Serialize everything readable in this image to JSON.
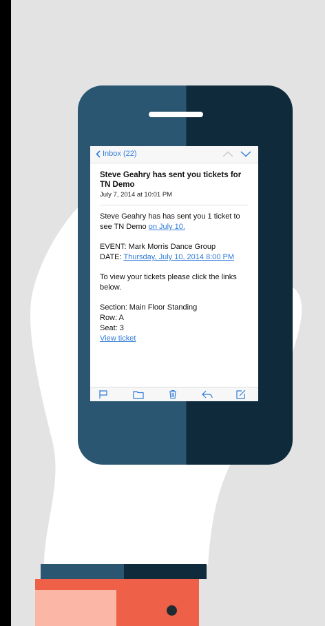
{
  "colors": {
    "background": "#e3e3e3",
    "phone_left": "#2a5672",
    "phone_right": "#0f2a3b",
    "hand": "#ffffff",
    "cuff": "#ee6048",
    "cuff_light": "#fbb6a6",
    "link": "#2f7bd8"
  },
  "nav": {
    "back_label": "Inbox (22)",
    "back_icon": "chevron-left-icon",
    "prev_icon": "chevron-up-icon",
    "next_icon": "chevron-down-icon"
  },
  "email": {
    "subject": "Steve Geahry has sent you tickets for TN Demo",
    "date": "July 7, 2014 at 10:01 PM",
    "intro_text": "Steve Geahry has has sent you 1 ticket to see TN Demo ",
    "intro_link": "on July 10.",
    "event_label": "EVENT: Mark Morris Dance Group",
    "date_label": "DATE: ",
    "date_link": "Thursday, July 10, 2014 8:00 PM",
    "instructions": "To view your tickets please click the links below.",
    "section": "Section: Main Floor Standing",
    "row": "Row: A",
    "seat": "Seat: 3",
    "view_ticket": "View ticket"
  },
  "toolbar": {
    "items": [
      "flag-icon",
      "folder-icon",
      "trash-icon",
      "reply-icon",
      "compose-icon"
    ]
  }
}
